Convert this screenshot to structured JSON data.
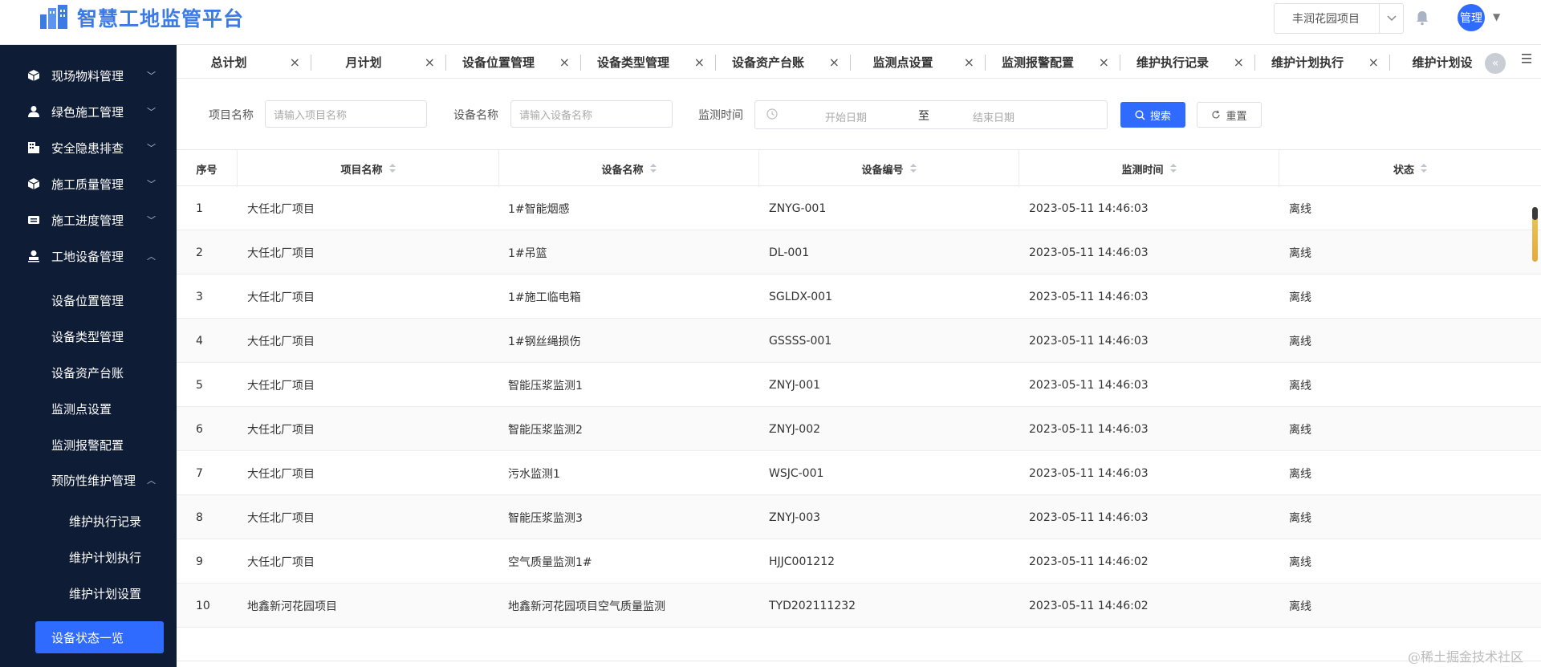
{
  "header": {
    "logo_text": "智慧工地监管平台",
    "project": "丰润花园项目",
    "user": "管理",
    "accent": "#2f6bff"
  },
  "sidebar": {
    "items": [
      {
        "label": "现场物料管理",
        "icon": "cube-icon",
        "expanded": false
      },
      {
        "label": "绿色施工管理",
        "icon": "person-icon",
        "expanded": false
      },
      {
        "label": "安全隐患排查",
        "icon": "building-icon",
        "expanded": false
      },
      {
        "label": "施工质量管理",
        "icon": "cube-icon",
        "expanded": false
      },
      {
        "label": "施工进度管理",
        "icon": "ticket-icon",
        "expanded": false
      },
      {
        "label": "工地设备管理",
        "icon": "stamp-icon",
        "expanded": true
      }
    ],
    "sub_items": [
      "设备位置管理",
      "设备类型管理",
      "设备资产台账",
      "监测点设置",
      "监测报警配置"
    ],
    "group": "预防性维护管理",
    "group_items": [
      "维护执行记录",
      "维护计划执行",
      "维护计划设置"
    ],
    "active": "设备状态一览"
  },
  "tabs": [
    "总计划",
    "月计划",
    "设备位置管理",
    "设备类型管理",
    "设备资产台账",
    "监测点设置",
    "监测报警配置",
    "维护执行记录",
    "维护计划执行",
    "维护计划设"
  ],
  "filters": {
    "project_label": "项目名称",
    "project_placeholder": "请输入项目名称",
    "device_label": "设备名称",
    "device_placeholder": "请输入设备名称",
    "time_label": "监测时间",
    "start_placeholder": "开始日期",
    "to": "至",
    "end_placeholder": "结束日期",
    "search": "搜索",
    "reset": "重置"
  },
  "table": {
    "columns": [
      "序号",
      "项目名称",
      "设备名称",
      "设备编号",
      "监测时间",
      "状态"
    ],
    "rows": [
      [
        "1",
        "大任北厂项目",
        "1#智能烟感",
        "ZNYG-001",
        "2023-05-11 14:46:03",
        "离线"
      ],
      [
        "2",
        "大任北厂项目",
        "1#吊篮",
        "DL-001",
        "2023-05-11 14:46:03",
        "离线"
      ],
      [
        "3",
        "大任北厂项目",
        "1#施工临电箱",
        "SGLDX-001",
        "2023-05-11 14:46:03",
        "离线"
      ],
      [
        "4",
        "大任北厂项目",
        "1#钢丝绳损伤",
        "GSSSS-001",
        "2023-05-11 14:46:03",
        "离线"
      ],
      [
        "5",
        "大任北厂项目",
        "智能压浆监测1",
        "ZNYJ-001",
        "2023-05-11 14:46:03",
        "离线"
      ],
      [
        "6",
        "大任北厂项目",
        "智能压浆监测2",
        "ZNYJ-002",
        "2023-05-11 14:46:03",
        "离线"
      ],
      [
        "7",
        "大任北厂项目",
        "污水监测1",
        "WSJC-001",
        "2023-05-11 14:46:03",
        "离线"
      ],
      [
        "8",
        "大任北厂项目",
        "智能压浆监测3",
        "ZNYJ-003",
        "2023-05-11 14:46:03",
        "离线"
      ],
      [
        "9",
        "大任北厂项目",
        "空气质量监测1#",
        "HJJC001212",
        "2023-05-11 14:46:02",
        "离线"
      ],
      [
        "10",
        "地鑫新河花园项目",
        "地鑫新河花园项目空气质量监测",
        "TYD202111232",
        "2023-05-11 14:46:02",
        "离线"
      ]
    ]
  },
  "watermark": "@稀土掘金技术社区"
}
